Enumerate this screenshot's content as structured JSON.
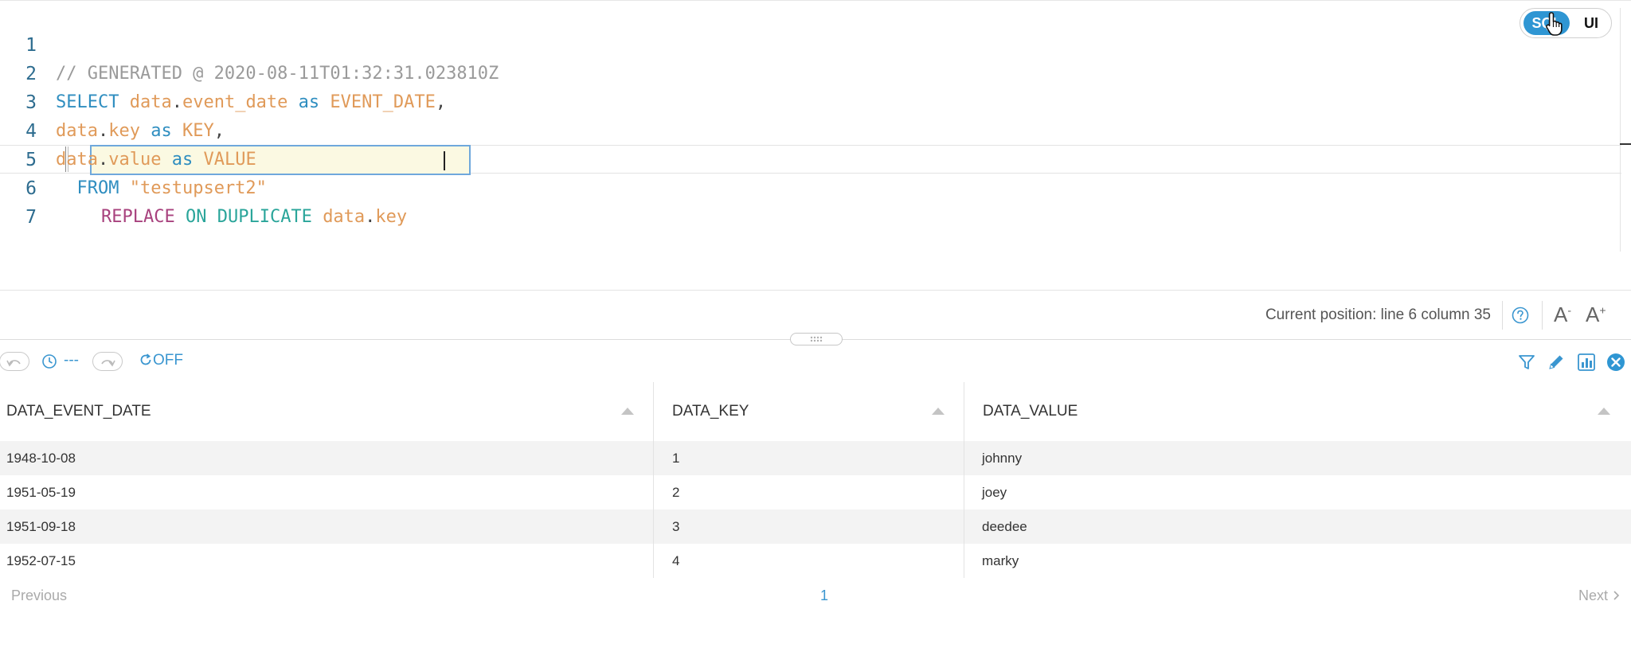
{
  "editor": {
    "line_numbers": [
      "1",
      "2",
      "3",
      "4",
      "5",
      "6",
      "7"
    ],
    "line1": {
      "comment": "// GENERATED @ 2020-08-11T01:32:31.023810Z"
    },
    "line2": {
      "kw": "SELECT",
      "obj": "data",
      "dot": ".",
      "field": "event_date",
      "as": "as",
      "alias": "EVENT_DATE",
      "comma": ","
    },
    "line3": {
      "obj": "data",
      "dot": ".",
      "field": "key",
      "as": "as",
      "alias": "KEY",
      "comma": ","
    },
    "line4": {
      "obj": "data",
      "dot": ".",
      "field": "value",
      "as": "as",
      "alias": "VALUE"
    },
    "line5": {
      "kw": "FROM",
      "table": "\"testupsert2\""
    },
    "line6": {
      "kw1": "REPLACE",
      "kw2": "ON",
      "kw3": "DUPLICATE",
      "obj": "data",
      "dot": ".",
      "field": "key"
    }
  },
  "mode_toggle": {
    "sql_label": "SQL",
    "ui_label": "UI",
    "active": "SQL"
  },
  "status": {
    "position_text": "Current position: line 6 column 35"
  },
  "font_controls": {
    "decrease": "A",
    "increase": "A",
    "minus": "-",
    "plus": "+"
  },
  "toolbar": {
    "history_text": "---",
    "refresh_label": "OFF"
  },
  "table": {
    "columns": [
      "DATA_EVENT_DATE",
      "DATA_KEY",
      "DATA_VALUE"
    ],
    "rows": [
      [
        "1948-10-08",
        "1",
        "johnny"
      ],
      [
        "1951-05-19",
        "2",
        "joey"
      ],
      [
        "1951-09-18",
        "3",
        "deedee"
      ],
      [
        "1952-07-15",
        "4",
        "marky"
      ]
    ]
  },
  "pager": {
    "previous": "Previous",
    "page": "1",
    "next": "Next"
  },
  "colors": {
    "accent": "#2f96d3",
    "link": "#3a96d0",
    "keyword": "#2f8ec0",
    "identifier": "#e09a59",
    "keyword_alt": "#a8427e",
    "keyword_teal": "#2aa59a"
  },
  "icons": [
    "undo-icon",
    "clock-icon",
    "redo-icon",
    "refresh-icon",
    "filter-icon",
    "pencil-icon",
    "chart-icon",
    "close-icon",
    "help-icon",
    "sort-asc-icon",
    "hand-cursor-icon"
  ]
}
